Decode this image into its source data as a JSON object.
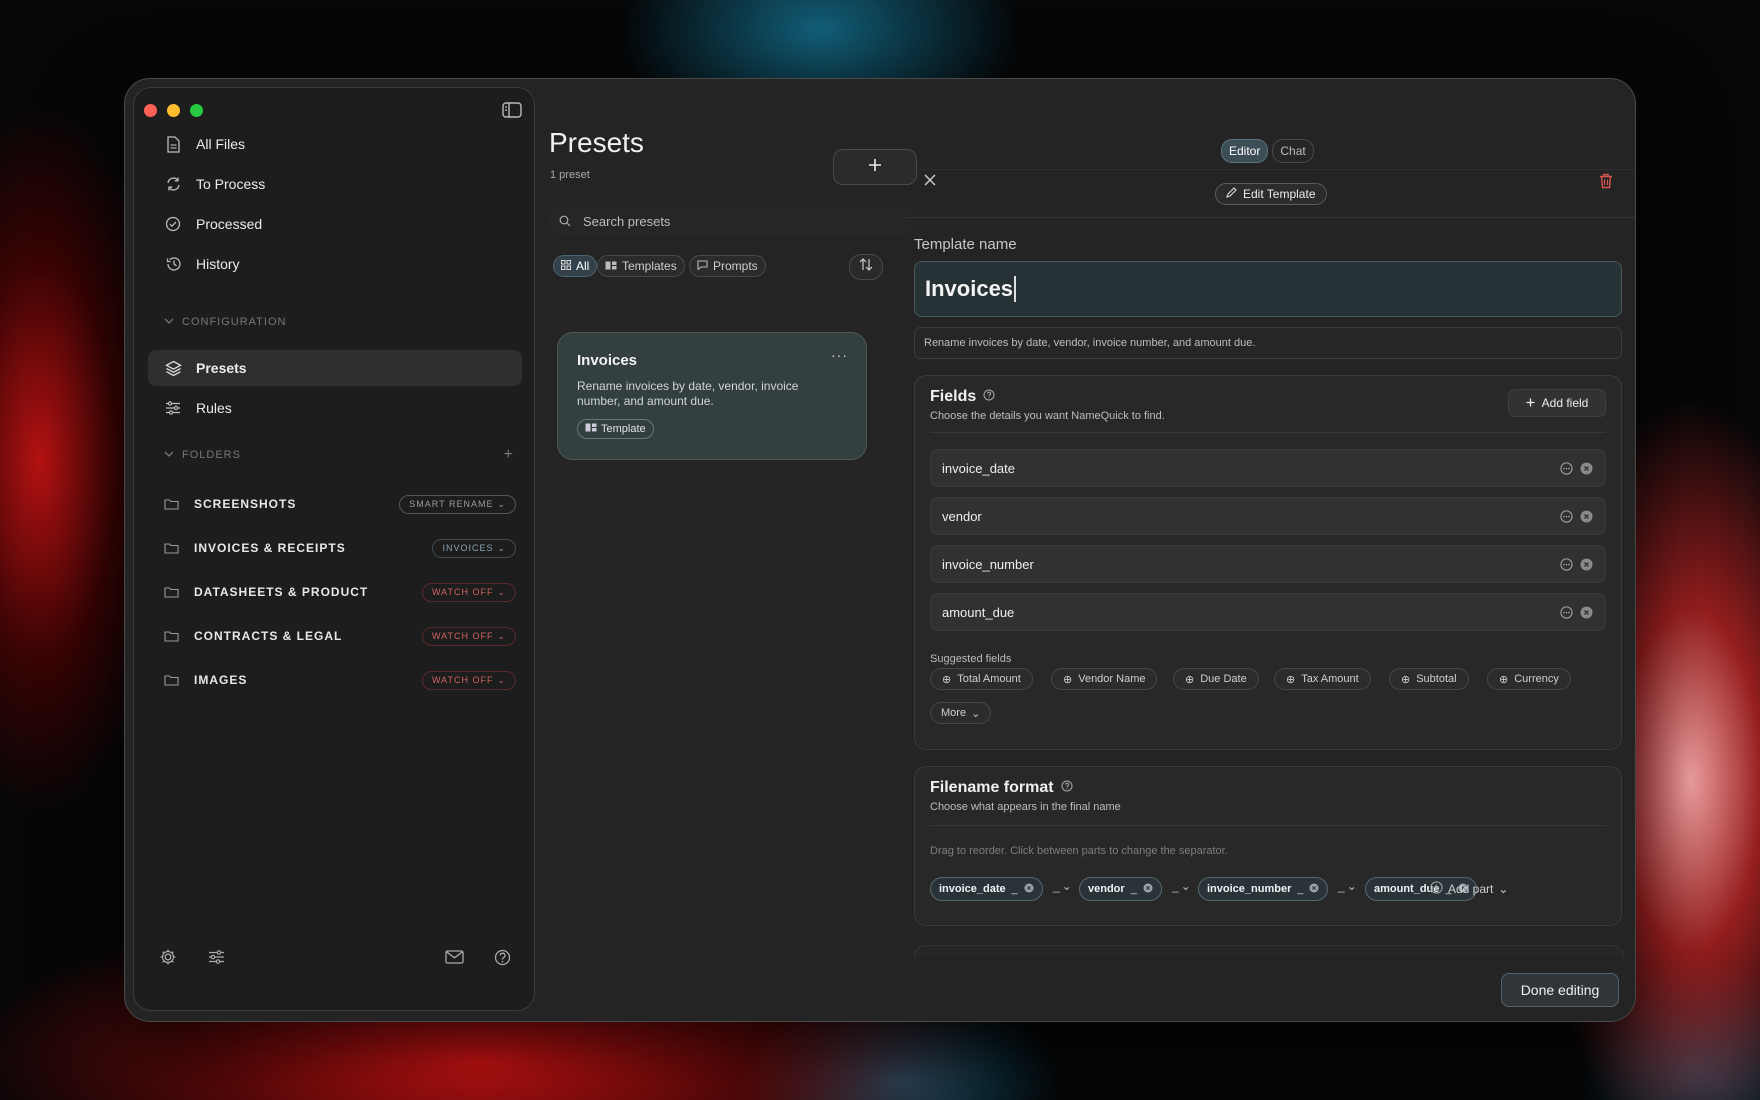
{
  "sidebar": {
    "nav": [
      {
        "label": "All Files",
        "icon": "document-icon"
      },
      {
        "label": "To Process",
        "icon": "refresh-icon"
      },
      {
        "label": "Processed",
        "icon": "check-circle-icon"
      },
      {
        "label": "History",
        "icon": "history-icon"
      }
    ],
    "configuration_label": "CONFIGURATION",
    "config_items": [
      {
        "label": "Presets",
        "icon": "layers-icon",
        "active": true
      },
      {
        "label": "Rules",
        "icon": "sliders-icon"
      }
    ],
    "folders_label": "FOLDERS",
    "folders": [
      {
        "name": "SCREENSHOTS",
        "badge": "SMART RENAME"
      },
      {
        "name": "INVOICES & RECEIPTS",
        "badge": "INVOICES"
      },
      {
        "name": "DATASHEETS & PRODUCT",
        "badge": "WATCH OFF"
      },
      {
        "name": "CONTRACTS & LEGAL",
        "badge": "WATCH OFF"
      },
      {
        "name": "IMAGES",
        "badge": "WATCH OFF"
      }
    ]
  },
  "presets": {
    "title": "Presets",
    "count": "1 preset",
    "search_placeholder": "Search presets",
    "filters": [
      "All",
      "Templates",
      "Prompts"
    ],
    "cards": [
      {
        "title": "Invoices",
        "description": "Rename invoices by date, vendor, invoice number, and amount due.",
        "badge": "Template"
      }
    ]
  },
  "editor": {
    "tabs": [
      "Editor",
      "Chat"
    ],
    "edit_template_label": "Edit Template",
    "template_name_label": "Template name",
    "template_name": "Invoices",
    "template_description": "Rename invoices by date, vendor, invoice number, and amount due.",
    "fields_title": "Fields",
    "fields_subtitle": "Choose the details you want NameQuick to find.",
    "add_field_label": "Add field",
    "fields": [
      "invoice_date",
      "vendor",
      "invoice_number",
      "amount_due"
    ],
    "suggested_label": "Suggested fields",
    "suggested": [
      "Total Amount",
      "Vendor Name",
      "Due Date",
      "Tax Amount",
      "Subtotal",
      "Currency"
    ],
    "more_label": "More",
    "format_title": "Filename format",
    "format_subtitle": "Choose what appears in the final name",
    "drag_hint": "Drag to reorder. Click between parts to change the separator.",
    "parts": [
      "invoice_date",
      "vendor",
      "invoice_number",
      "amount_due"
    ],
    "separator": "_",
    "add_part_label": "Add part",
    "done_label": "Done editing"
  },
  "colors": {
    "accent": "#4c6470",
    "danger": "#d9534f",
    "watch_off": "#d06363"
  }
}
